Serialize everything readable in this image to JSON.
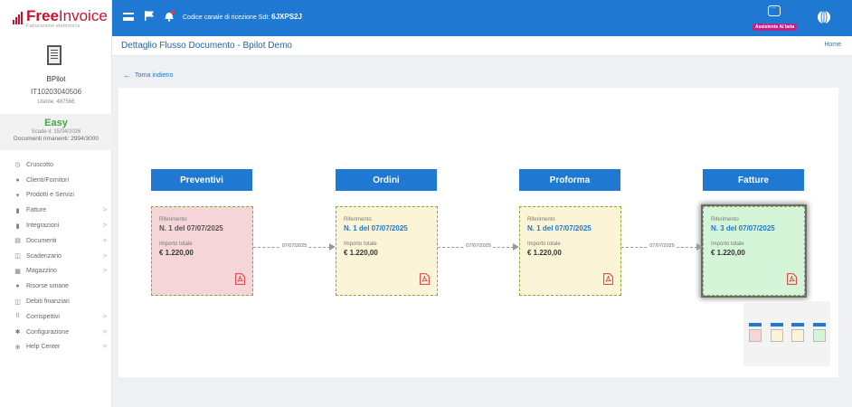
{
  "brand": {
    "name_part1": "Free",
    "name_part2": "Invoice",
    "tagline": "Fatturazione elettronica"
  },
  "user": {
    "name": "BPilot",
    "piva": "IT10203040506",
    "id_label": "Utente: 487566"
  },
  "plan": {
    "name": "Easy",
    "expiry": "Scade il: 15/04/2026",
    "docs_left": "Documenti rimanenti: 2994/3000"
  },
  "menu": [
    {
      "label": "Cruscotto",
      "icon": "dashboard-icon",
      "chevron": ""
    },
    {
      "label": "Clienti/Fornitori",
      "icon": "person-icon",
      "chevron": ""
    },
    {
      "label": "Prodotti e Servizi",
      "icon": "basket-icon",
      "chevron": ""
    },
    {
      "label": "Fatture",
      "icon": "file-icon",
      "chevron": ">"
    },
    {
      "label": "Integrazioni",
      "icon": "file-icon",
      "chevron": ">"
    },
    {
      "label": "Documenti",
      "icon": "documents-icon",
      "chevron": ">"
    },
    {
      "label": "Scadenzario",
      "icon": "money-icon",
      "chevron": ">"
    },
    {
      "label": "Magazzino",
      "icon": "warehouse-icon",
      "chevron": ">"
    },
    {
      "label": "Risorse umane",
      "icon": "person-icon",
      "chevron": ""
    },
    {
      "label": "Debiti finanziari",
      "icon": "money-icon",
      "chevron": ""
    },
    {
      "label": "Corrispettivi",
      "icon": "receipt-icon",
      "chevron": ">"
    },
    {
      "label": "Configurazione",
      "icon": "gear-icon",
      "chevron": ">"
    },
    {
      "label": "Help Center",
      "icon": "lifebuoy-icon",
      "chevron": ">"
    }
  ],
  "topbar": {
    "channel_label": "Codice canale di ricezione SdI:",
    "channel_code": "6JXPS2J",
    "assistant_label": "Assistente AI",
    "assistant_badge_extra": "beta"
  },
  "header": {
    "title": "Dettaglio Flusso Documento - Bpilot Demo",
    "home": "Home"
  },
  "back_label": "Torna indietro",
  "flow": [
    {
      "stage": "Preventivi",
      "ref_label": "Riferimento",
      "ref": "N. 1 del 07/07/2025",
      "amount_label": "Importo totale",
      "amount": "€ 1.220,00",
      "ref_color": "#555555",
      "card_color": "red"
    },
    {
      "stage": "Ordini",
      "ref_label": "Riferimento",
      "ref": "N. 1 del 07/07/2025",
      "amount_label": "Importo totale",
      "amount": "€ 1.220,00",
      "ref_color": "#1f78d1",
      "card_color": "yellow"
    },
    {
      "stage": "Proforma",
      "ref_label": "Riferimento",
      "ref": "N. 1 del 07/07/2025",
      "amount_label": "Importo totale",
      "amount": "€ 1.220,00",
      "ref_color": "#1f78d1",
      "card_color": "yellow"
    },
    {
      "stage": "Fatture",
      "ref_label": "Riferimento",
      "ref": "N. 3 del 07/07/2025",
      "amount_label": "Importo totale",
      "amount": "€ 1.220,00",
      "ref_color": "#1f78d1",
      "card_color": "green"
    }
  ],
  "connectors": [
    "07/07/2025",
    "07/07/2025",
    "07/07/2025"
  ],
  "colors": {
    "primary": "#1f78d1",
    "brand_red": "#c8102e",
    "plan_green": "#3cab3c",
    "pdf_red": "#e0393e"
  }
}
